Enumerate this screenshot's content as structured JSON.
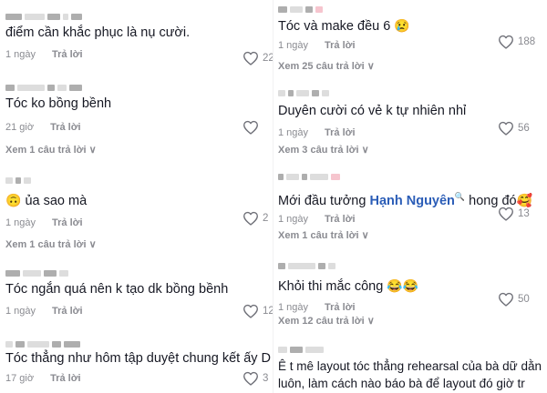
{
  "left": {
    "c1": {
      "text": "điểm cần khắc phục là nụ cười.",
      "time": "1 ngày",
      "reply": "Trả lời",
      "likes": "22"
    },
    "c2": {
      "text": "Tóc ko bồng bềnh",
      "time": "21 giờ",
      "reply": "Trả lời",
      "more": "Xem 1 câu trả lời"
    },
    "c3": {
      "emoji": "🙃",
      "text": " ủa sao mà",
      "time": "1 ngày",
      "reply": "Trả lời",
      "likes": "2",
      "more": "Xem 1 câu trả lời"
    },
    "c4": {
      "text": "Tóc ngắn quá nên k tạo dk bồng bềnh",
      "time": "1 ngày",
      "reply": "Trả lời",
      "likes": "12"
    },
    "c5": {
      "text": "Tóc thẳng như hôm tập duyệt chung kết ấy D",
      "time": "17 giờ",
      "reply": "Trả lời",
      "likes": "3"
    }
  },
  "right": {
    "c1": {
      "text": "Tóc và make đều 6 ",
      "emoji": "😢",
      "time": "1 ngày",
      "reply": "Trả lời",
      "likes": "188",
      "more": "Xem 25 câu trả lời"
    },
    "c2": {
      "text": "Duyên cười có vẻ k tự nhiên nhỉ",
      "time": "1 ngày",
      "reply": "Trả lời",
      "likes": "56",
      "more": "Xem 3 câu trả lời"
    },
    "c3": {
      "text_before": "Mới đầu tưởng ",
      "mention": "Hạnh Nguyên",
      "mention_icon": "🔍",
      "text_after": " hong đó",
      "emoji": "🥰",
      "time": "1 ngày",
      "reply": "Trả lời",
      "likes": "13",
      "more": "Xem 1 câu trả lời"
    },
    "c4": {
      "text": "Khỏi thi mắc công ",
      "emoji": "😂😂",
      "time": "1 ngày",
      "reply": "Trả lời",
      "likes": "50",
      "more": "Xem 12 câu trả lời"
    },
    "c5": {
      "text": "Ê t mê layout tóc thẳng rehearsal của bà dữ dằn luôn, làm cách nào báo bà để layout đó giờ tr"
    }
  }
}
